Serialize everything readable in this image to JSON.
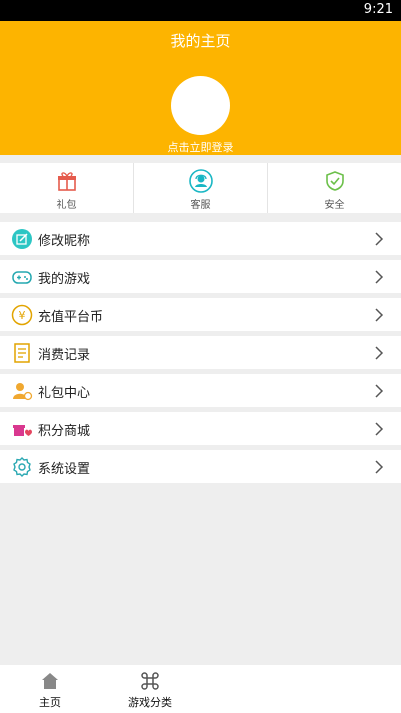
{
  "status_bar": {
    "time": "9:21"
  },
  "header": {
    "title": "我的主页",
    "login_text": "点击立即登录"
  },
  "quick_actions": [
    {
      "label": "礼包",
      "icon": "gift-icon"
    },
    {
      "label": "客服",
      "icon": "customer-service-icon"
    },
    {
      "label": "安全",
      "icon": "shield-icon"
    }
  ],
  "menu": [
    {
      "label": "修改昵称",
      "icon": "edit-icon"
    },
    {
      "label": "我的游戏",
      "icon": "gamepad-icon"
    },
    {
      "label": "充值平台币",
      "icon": "yuan-coin-icon"
    },
    {
      "label": "消费记录",
      "icon": "document-icon"
    },
    {
      "label": "礼包中心",
      "icon": "user-gift-icon"
    },
    {
      "label": "积分商城",
      "icon": "store-icon"
    },
    {
      "label": "系统设置",
      "icon": "gear-icon"
    }
  ],
  "bottom_nav": [
    {
      "label": "主页",
      "icon": "home-icon"
    },
    {
      "label": "游戏分类",
      "icon": "command-icon"
    }
  ],
  "colors": {
    "accent": "#fdb400",
    "background": "#eeeeee"
  }
}
